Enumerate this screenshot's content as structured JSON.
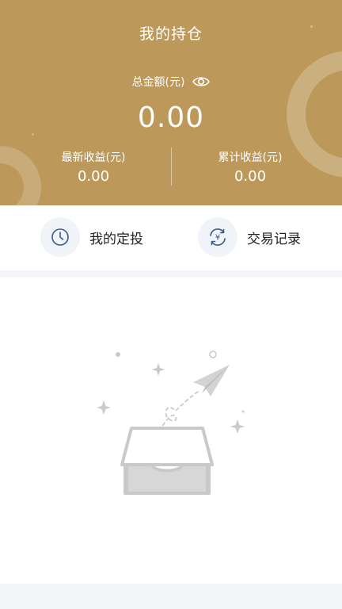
{
  "header": {
    "title": "我的持仓",
    "total_label": "总金额(元)",
    "total_value": "0.00",
    "latest_profit_label": "最新收益(元)",
    "latest_profit_value": "0.00",
    "cumulative_profit_label": "累计收益(元)",
    "cumulative_profit_value": "0.00",
    "eye_icon": "eye-icon"
  },
  "actions": [
    {
      "label": "我的定投",
      "icon": "clock-icon"
    },
    {
      "label": "交易记录",
      "icon": "yuan-refresh-icon"
    }
  ],
  "empty_state": {
    "icon": "empty-inbox-paper-plane-illustration"
  },
  "colors": {
    "brand_gold": "#bc995b",
    "icon_blue": "#3d5a86",
    "page_bg": "#f3f5f9"
  }
}
